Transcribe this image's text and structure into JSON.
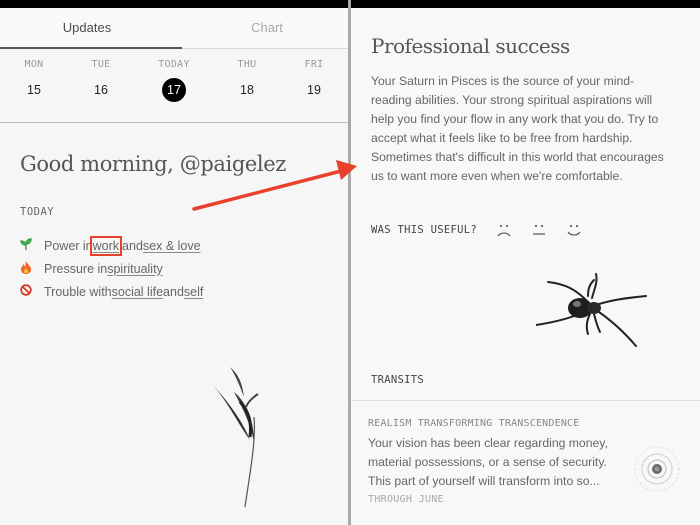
{
  "left": {
    "tabs": [
      {
        "label": "Updates",
        "active": true
      },
      {
        "label": "Chart",
        "active": false
      }
    ],
    "days": [
      {
        "name": "MON",
        "date": "15",
        "today": false
      },
      {
        "name": "TUE",
        "date": "16",
        "today": false
      },
      {
        "name": "TODAY",
        "date": "17",
        "today": true
      },
      {
        "name": "THU",
        "date": "18",
        "today": false
      },
      {
        "name": "FRI",
        "date": "19",
        "today": false
      }
    ],
    "greeting": "Good morning, @paigelez",
    "section_label": "TODAY",
    "items": [
      {
        "icon": "seedling-icon",
        "glyph": "🌱",
        "parts": [
          "Power in ",
          "work",
          " and ",
          "sex & love"
        ]
      },
      {
        "icon": "fire-icon",
        "glyph": "🔥",
        "parts": [
          "Pressure in ",
          "spirituality"
        ]
      },
      {
        "icon": "no-entry-icon",
        "glyph": "🚫",
        "parts": [
          "Trouble with ",
          "social life",
          " and ",
          "self"
        ]
      }
    ],
    "highlight_color": "#e8402a"
  },
  "right": {
    "title": "Professional success",
    "body": "Your Saturn in Pisces is the source of your mind-reading abilities. Your strong spiritual aspirations will help you find your flow in any work that you do. Try to accept what it feels like to be free from hardship. Sometimes that's difficult in this world that encourages us to want more even when we're comfortable.",
    "useful_label": "WAS THIS USEFUL?",
    "faces": [
      "sad-face-icon",
      "neutral-face-icon",
      "happy-face-icon"
    ],
    "transits_label": "TRANSITS",
    "transit": {
      "title": "REALISM TRANSFORMING TRANSCENDENCE",
      "body": "Your vision has been clear regarding money, material possessions, or a sense of security. This part of yourself will transform into so...",
      "when": "THROUGH JUNE"
    }
  },
  "annotation": {
    "arrow_color": "#e8402a"
  }
}
